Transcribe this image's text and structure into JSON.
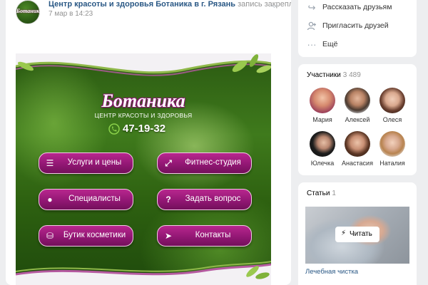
{
  "post": {
    "author": "Центр красоты и здоровья Ботаника в г. Рязань",
    "pinned_note": "запись закреплена",
    "date": "7 мар в 14:23",
    "avatar_text": "Ботаника",
    "menu_glyph": "⌵"
  },
  "banner": {
    "brand": "Ботаника",
    "tagline": "ЦЕНТР КРАСОТЫ И ЗДОРОВЬЯ",
    "phone": "47-19-32",
    "buttons": [
      {
        "label": "Услуги и цены",
        "icon": "list-icon",
        "glyph": "☰"
      },
      {
        "label": "Фитнес-студия",
        "icon": "dumbbell-icon",
        "glyph": "⤢"
      },
      {
        "label": "Специалисты",
        "icon": "person-icon",
        "glyph": "●"
      },
      {
        "label": "Задать вопрос",
        "icon": "question-icon",
        "glyph": "?"
      },
      {
        "label": "Бутик косметики",
        "icon": "basket-icon",
        "glyph": "⛁"
      },
      {
        "label": "Контакты",
        "icon": "send-icon",
        "glyph": "➤"
      }
    ],
    "colors": {
      "button": "#8f1672",
      "button_border": "#f3c9e6",
      "green": "#3f7a1c"
    }
  },
  "actions": [
    {
      "label": "Рассказать друзьям",
      "icon": "share-icon",
      "glyph": "↪"
    },
    {
      "label": "Пригласить друзей",
      "icon": "add-user-icon",
      "glyph": "⍝"
    },
    {
      "label": "Ещё",
      "icon": "more-icon",
      "glyph": "···"
    }
  ],
  "members": {
    "title": "Участники",
    "count": "3 489",
    "list": [
      {
        "name": "Мария"
      },
      {
        "name": "Алексей"
      },
      {
        "name": "Олеся"
      },
      {
        "name": "Юлечка"
      },
      {
        "name": "Анастасия"
      },
      {
        "name": "Наталия"
      }
    ]
  },
  "articles": {
    "title": "Статьи",
    "count": "1",
    "read_label": "Читать",
    "read_icon": "⚡",
    "article_title": "Лечебная чистка"
  },
  "colors": {
    "link": "#2a5885",
    "muted": "#939393",
    "page_bg": "#edeef0"
  }
}
